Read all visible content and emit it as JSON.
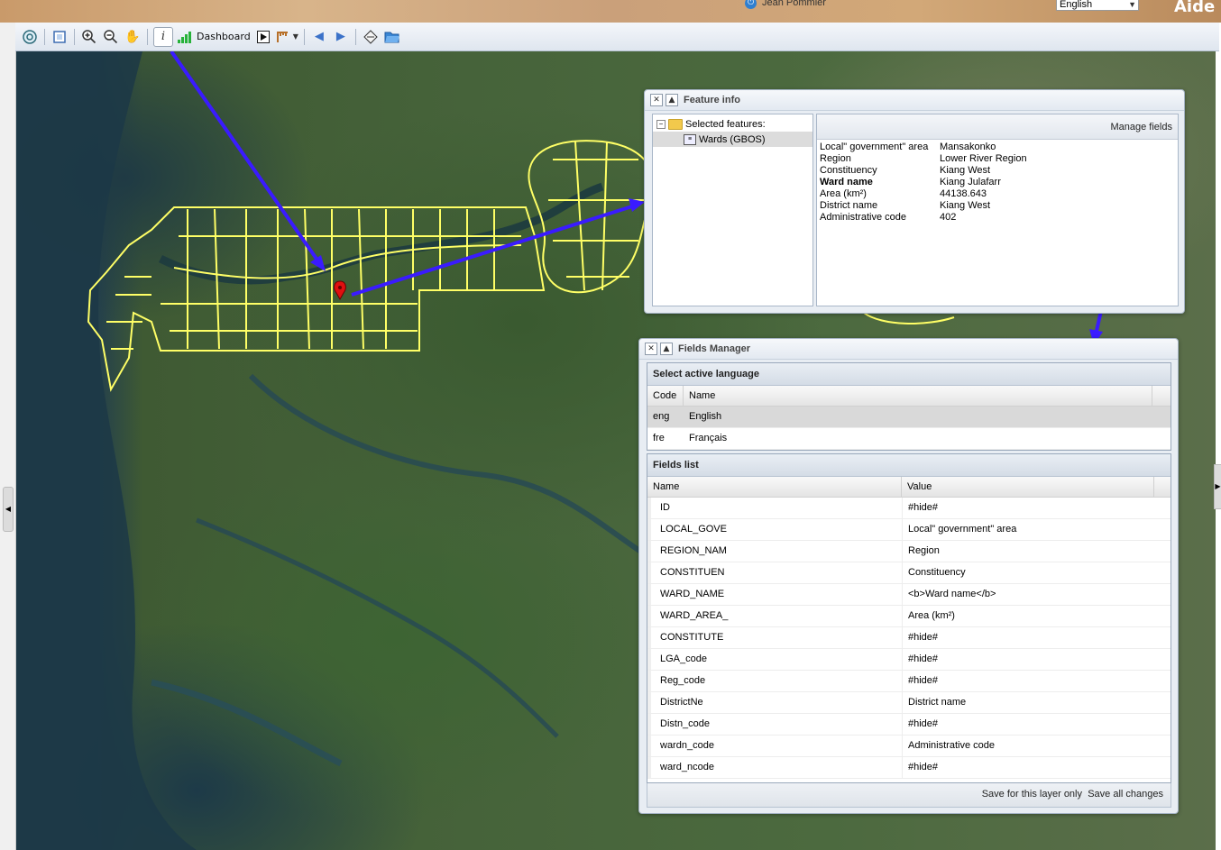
{
  "header": {
    "user_name": "Jean Pommier",
    "language": "English",
    "help_label": "Aide"
  },
  "toolbar": {
    "dashboard_label": "Dashboard"
  },
  "colors": {
    "boundary": "#ffff66",
    "arrow": "#3a1bff",
    "marker": "#e01010"
  },
  "feature_info": {
    "title": "Feature info",
    "tree": {
      "root_label": "Selected features:",
      "layer_label": "Wards (GBOS)"
    },
    "manage_fields_label": "Manage fields",
    "attributes": [
      {
        "key": "Local\" government\" area",
        "value": "Mansakonko",
        "bold": false
      },
      {
        "key": "Region",
        "value": "Lower River Region",
        "bold": false
      },
      {
        "key": "Constituency",
        "value": "Kiang West",
        "bold": false
      },
      {
        "key": "Ward name",
        "value": "Kiang Julafarr",
        "bold": true
      },
      {
        "key": "Area (km²)",
        "value": "44138.643",
        "bold": false
      },
      {
        "key": "District name",
        "value": "Kiang West",
        "bold": false
      },
      {
        "key": "Administrative code",
        "value": "402",
        "bold": false
      }
    ]
  },
  "fields_manager": {
    "title": "Fields Manager",
    "language_panel": {
      "title": "Select active language",
      "columns": [
        "Code",
        "Name"
      ],
      "rows": [
        {
          "code": "eng",
          "name": "English",
          "selected": true
        },
        {
          "code": "fre",
          "name": "Français",
          "selected": false
        }
      ]
    },
    "fields_panel": {
      "title": "Fields list",
      "columns": [
        "Name",
        "Value"
      ],
      "rows": [
        {
          "name": "ID",
          "value": "#hide#"
        },
        {
          "name": "LOCAL_GOVE",
          "value": "Local\" government\" area"
        },
        {
          "name": "REGION_NAM",
          "value": "Region"
        },
        {
          "name": "CONSTITUEN",
          "value": "Constituency"
        },
        {
          "name": "WARD_NAME",
          "value": "<b>Ward name</b>"
        },
        {
          "name": "WARD_AREA_",
          "value": "Area (km²)"
        },
        {
          "name": "CONSTITUTE",
          "value": "#hide#"
        },
        {
          "name": "LGA_code",
          "value": "#hide#"
        },
        {
          "name": "Reg_code",
          "value": "#hide#"
        },
        {
          "name": "DistrictNe",
          "value": "District name"
        },
        {
          "name": "Distn_code",
          "value": "#hide#"
        },
        {
          "name": "wardn_code",
          "value": "Administrative code"
        },
        {
          "name": "ward_ncode",
          "value": "#hide#"
        }
      ]
    },
    "save_layer_label": "Save for this layer only",
    "save_all_label": "Save all changes"
  }
}
